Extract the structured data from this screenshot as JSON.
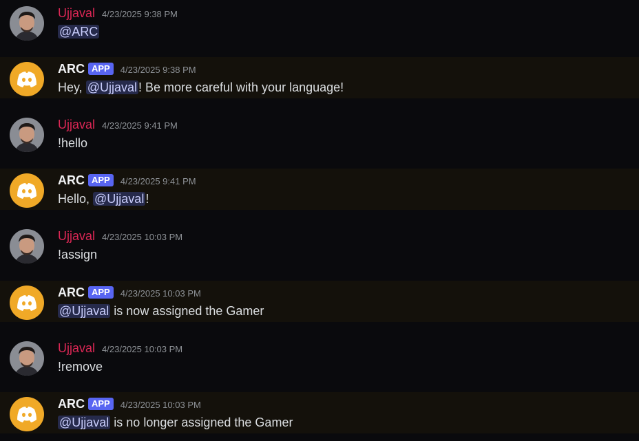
{
  "colors": {
    "background": "#0a0a0d",
    "bot_row_background": "#14110b",
    "user_name": "#dc2755",
    "mention_bg": "#262a4b",
    "app_tag": "#5865f2",
    "bot_avatar": "#f0a927"
  },
  "messages": [
    {
      "author": "Ujjaval",
      "timestamp": "4/23/2025 9:38 PM",
      "parts": [
        {
          "mention": "@ARC"
        }
      ]
    },
    {
      "author": "ARC",
      "tag": "APP",
      "timestamp": "4/23/2025 9:38 PM",
      "parts": [
        {
          "text": "Hey, "
        },
        {
          "mention": "@Ujjaval"
        },
        {
          "text": "! Be more careful with your language!"
        }
      ]
    },
    {
      "author": "Ujjaval",
      "timestamp": "4/23/2025 9:41 PM",
      "parts": [
        {
          "text": "!hello"
        }
      ]
    },
    {
      "author": "ARC",
      "tag": "APP",
      "timestamp": "4/23/2025 9:41 PM",
      "parts": [
        {
          "text": "Hello, "
        },
        {
          "mention": "@Ujjaval"
        },
        {
          "text": "!"
        }
      ]
    },
    {
      "author": "Ujjaval",
      "timestamp": "4/23/2025 10:03 PM",
      "parts": [
        {
          "text": "!assign"
        }
      ]
    },
    {
      "author": "ARC",
      "tag": "APP",
      "timestamp": "4/23/2025 10:03 PM",
      "parts": [
        {
          "mention": "@Ujjaval"
        },
        {
          "text": " is now assigned the Gamer"
        }
      ]
    },
    {
      "author": "Ujjaval",
      "timestamp": "4/23/2025 10:03 PM",
      "parts": [
        {
          "text": "!remove"
        }
      ]
    },
    {
      "author": "ARC",
      "tag": "APP",
      "timestamp": "4/23/2025 10:03 PM",
      "parts": [
        {
          "mention": "@Ujjaval"
        },
        {
          "text": " is no longer assigned the Gamer"
        }
      ]
    }
  ]
}
